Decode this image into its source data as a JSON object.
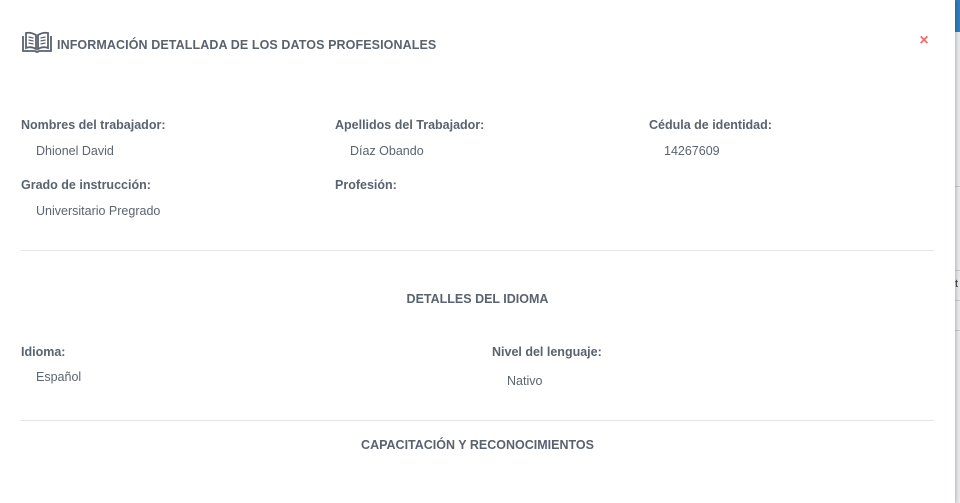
{
  "modal": {
    "title": "INFORMACIÓN DETALLADA DE LOS DATOS PROFESIONALES",
    "close_label": "×",
    "title_icon": "book-open-icon",
    "close_color": "#f26b6b"
  },
  "worker": {
    "first_names_label": "Nombres del trabajador:",
    "first_names_value": "Dhionel David",
    "last_names_label": "Apellidos del Trabajador:",
    "last_names_value": "Díaz Obando",
    "id_label": "Cédula de identidad:",
    "id_value": "14267609",
    "education_label": "Grado de instrucción:",
    "education_value": "Universitario Pregrado",
    "profession_label": "Profesión:",
    "profession_value": ""
  },
  "language_section": {
    "title": "DETALLES DEL IDIOMA",
    "language_label": "Idioma:",
    "language_value": "Español",
    "level_label": "Nivel del lenguaje:",
    "level_value": "Nativo"
  },
  "training_section": {
    "title": "CAPACITACIÓN Y RECONOCIMIENTOS"
  },
  "backdrop": {
    "edge_glyph": "t"
  }
}
